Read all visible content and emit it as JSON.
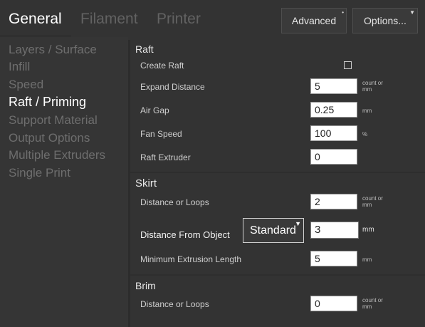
{
  "tabs": [
    {
      "label": "General"
    },
    {
      "label": "Filament"
    },
    {
      "label": "Printer"
    }
  ],
  "buttons": {
    "advanced": "Advanced",
    "options": "Options..."
  },
  "sidebar": {
    "items": [
      {
        "label": "Layers / Surface"
      },
      {
        "label": "Infill"
      },
      {
        "label": "Speed"
      },
      {
        "label": "Raft / Priming"
      },
      {
        "label": "Support Material"
      },
      {
        "label": "Output Options"
      },
      {
        "label": "Multiple Extruders"
      },
      {
        "label": "Single Print"
      }
    ],
    "active_index": 3
  },
  "raft": {
    "title": "Raft",
    "create_raft": {
      "label": "Create Raft",
      "checked": false
    },
    "expand_distance": {
      "label": "Expand Distance",
      "value": "5",
      "unit": "count or mm"
    },
    "air_gap": {
      "label": "Air Gap",
      "value": "0.25",
      "unit": "mm"
    },
    "fan_speed": {
      "label": "Fan Speed",
      "value": "100",
      "unit": "%"
    },
    "raft_extruder": {
      "label": "Raft Extruder",
      "value": "0"
    }
  },
  "skirt": {
    "title": "Skirt",
    "distance_or_loops": {
      "label": "Distance or Loops",
      "value": "2",
      "unit": "count or mm"
    },
    "distance_from_object": {
      "label": "Distance From Object",
      "mode": "Standard",
      "value": "3",
      "unit": "mm"
    },
    "min_extrusion_length": {
      "label": "Minimum Extrusion Length",
      "value": "5",
      "unit": "mm"
    }
  },
  "brim": {
    "title": "Brim",
    "distance_or_loops": {
      "label": "Distance or Loops",
      "value": "0",
      "unit": "count or mm"
    }
  }
}
